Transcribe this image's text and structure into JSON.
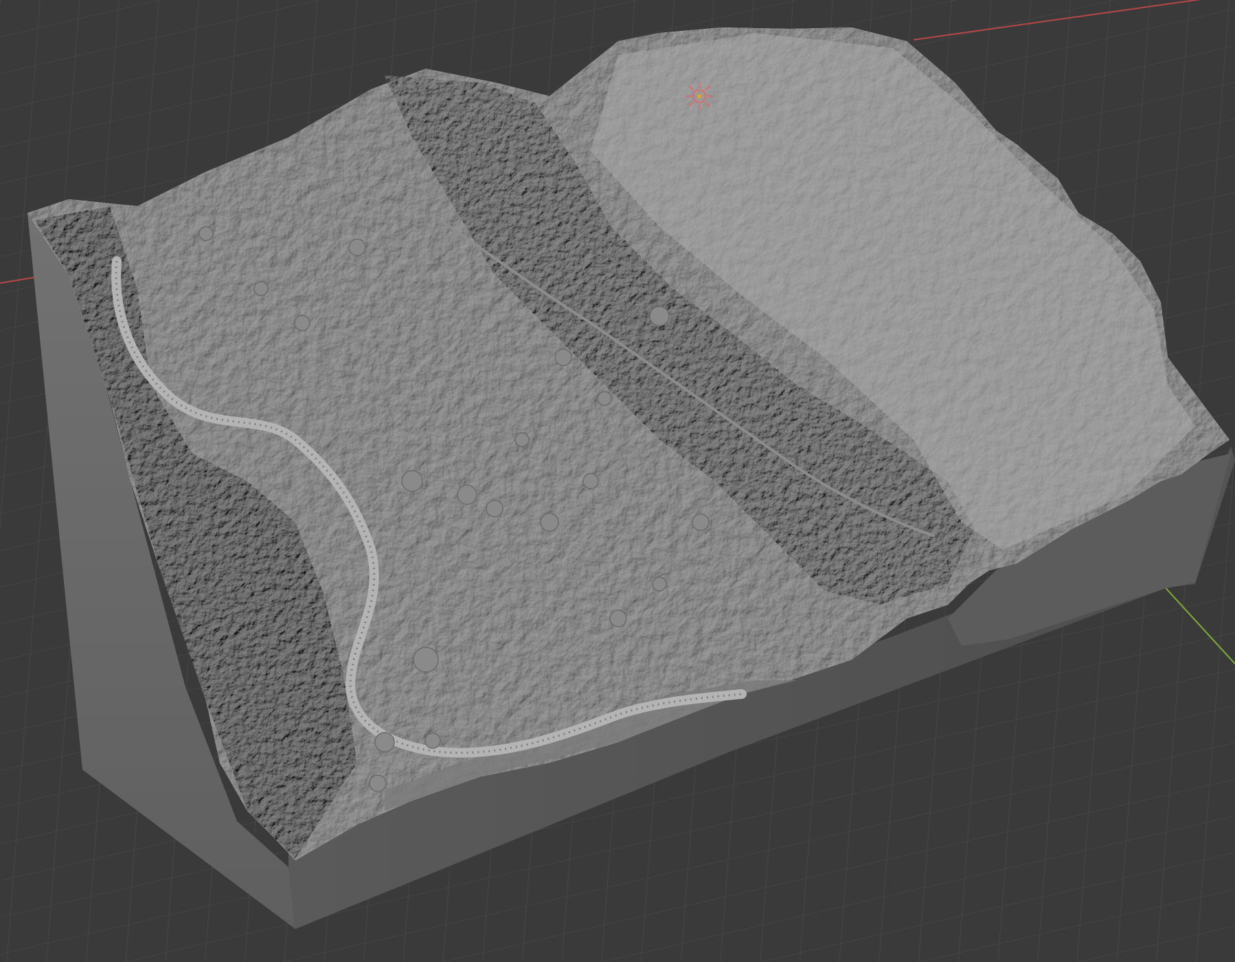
{
  "app": {
    "type": "3D viewport",
    "shading": "solid"
  },
  "viewport": {
    "background_color": "#3a3a3a",
    "grid_line_color": "#4a4a4a",
    "x_axis_color": "#b84848",
    "y_axis_color": "#7fae3a",
    "mesh_top_color": "#9a9a9a",
    "mesh_side_front_color": "#5e5e5e",
    "mesh_side_left_color": "#6b6b6b",
    "mesh_side_right_color": "#565656"
  },
  "scene": {
    "object": "terrain-mesh",
    "features": [
      "terrain-block",
      "river-channel",
      "tree-canopy",
      "scene-origin-marker"
    ]
  }
}
